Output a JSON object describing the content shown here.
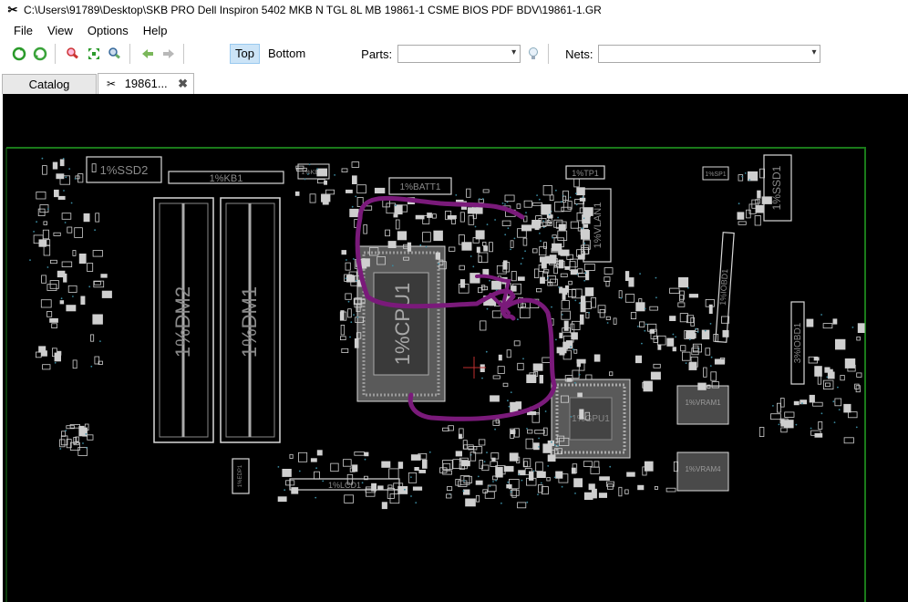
{
  "window": {
    "title": "C:\\Users\\91789\\Desktop\\SKB PRO Dell Inspiron 5402 MKB N TGL 8L MB 19861-1 CSME BIOS PDF BDV\\19861-1.GR",
    "app_icon": "scissors-x-icon"
  },
  "menu": [
    "File",
    "View",
    "Options",
    "Help"
  ],
  "toolbar": {
    "buttons": [
      "refresh-green-icon",
      "rotate-icon",
      "zoom-red-icon",
      "fit-green-icon",
      "zoom-in-icon",
      "arrow-left-icon",
      "arrow-right-icon"
    ],
    "top_label": "Top",
    "bottom_label": "Bottom",
    "parts_label": "Parts:",
    "parts_value": "",
    "nets_label": "Nets:",
    "nets_value": "",
    "bulb_icon": "lightbulb-icon"
  },
  "tabs": [
    {
      "label": "Catalog",
      "active": false
    },
    {
      "label": "19861...",
      "active": true
    }
  ],
  "board": {
    "labels": {
      "ssd2": "1%SSD2",
      "kb1": "1%KB1",
      "kbbl": "1%KB01",
      "batt1": "1%BATT1",
      "tp1": "1%TP1",
      "vlan1": "1%VLAN1",
      "ssd1": "1%SSD1",
      "sp1": "1%SP1",
      "iobd": "1%IOBD1",
      "iobd3": "3%IOBD1",
      "dm2": "1%DM2",
      "dm1": "1%DM1",
      "cpu": "1%CPU1",
      "gpu": "1%GPU1",
      "vram1": "1%VRAM1",
      "vram4": "1%VRAM4",
      "lcd": "1%LCD1",
      "edp": "1%EDP1"
    },
    "colors": {
      "background": "#000000",
      "outline": "#1a7a1a",
      "trace": "#d8d8d8",
      "annotation": "#7a1a7a",
      "marker": "#c03030"
    }
  }
}
